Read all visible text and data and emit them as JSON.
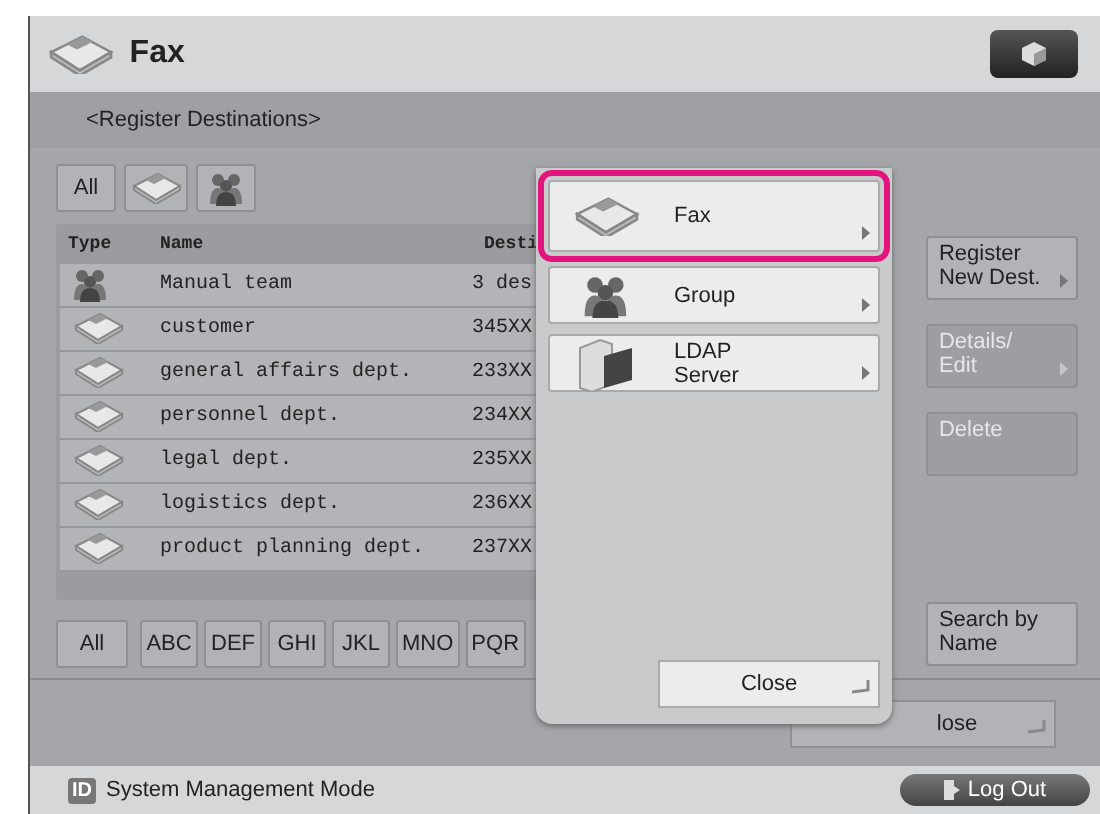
{
  "header": {
    "title": "Fax"
  },
  "subheader": "<Register Destinations>",
  "filters": [
    {
      "kind": "text",
      "label": "All"
    },
    {
      "kind": "fax"
    },
    {
      "kind": "group"
    }
  ],
  "table": {
    "columns": [
      "Type",
      "Name",
      "Desti"
    ],
    "rows": [
      {
        "kind": "group",
        "name": "Manual team",
        "destination": "3 des"
      },
      {
        "kind": "fax",
        "name": "customer",
        "destination": "345XX"
      },
      {
        "kind": "fax",
        "name": "general affairs dept.",
        "destination": "233XX"
      },
      {
        "kind": "fax",
        "name": "personnel dept.",
        "destination": "234XX"
      },
      {
        "kind": "fax",
        "name": "legal dept.",
        "destination": "235XX"
      },
      {
        "kind": "fax",
        "name": "logistics dept.",
        "destination": "236XX"
      },
      {
        "kind": "fax",
        "name": "product planning dept.",
        "destination": "237XX"
      }
    ]
  },
  "letters": [
    "All",
    "ABC",
    "DEF",
    "GHI",
    "JKL",
    "MNO",
    "PQR"
  ],
  "side_buttons": [
    {
      "label": "Register\nNew Dest.",
      "disabled": false,
      "arrow": true
    },
    {
      "label": "Details/\nEdit",
      "disabled": true,
      "arrow": true
    },
    {
      "label": "Delete",
      "disabled": true,
      "arrow": false
    }
  ],
  "search_button": "Search by\nName",
  "close_button": "lose",
  "popup": {
    "items": [
      {
        "kind": "fax",
        "label": "Fax",
        "selected": true
      },
      {
        "kind": "group",
        "label": "Group",
        "selected": false
      },
      {
        "kind": "server",
        "label": "LDAP\nServer",
        "selected": false
      }
    ],
    "close": "Close"
  },
  "status_bar": {
    "badge": "ID",
    "mode": "System Management Mode",
    "logout": "Log Out"
  }
}
